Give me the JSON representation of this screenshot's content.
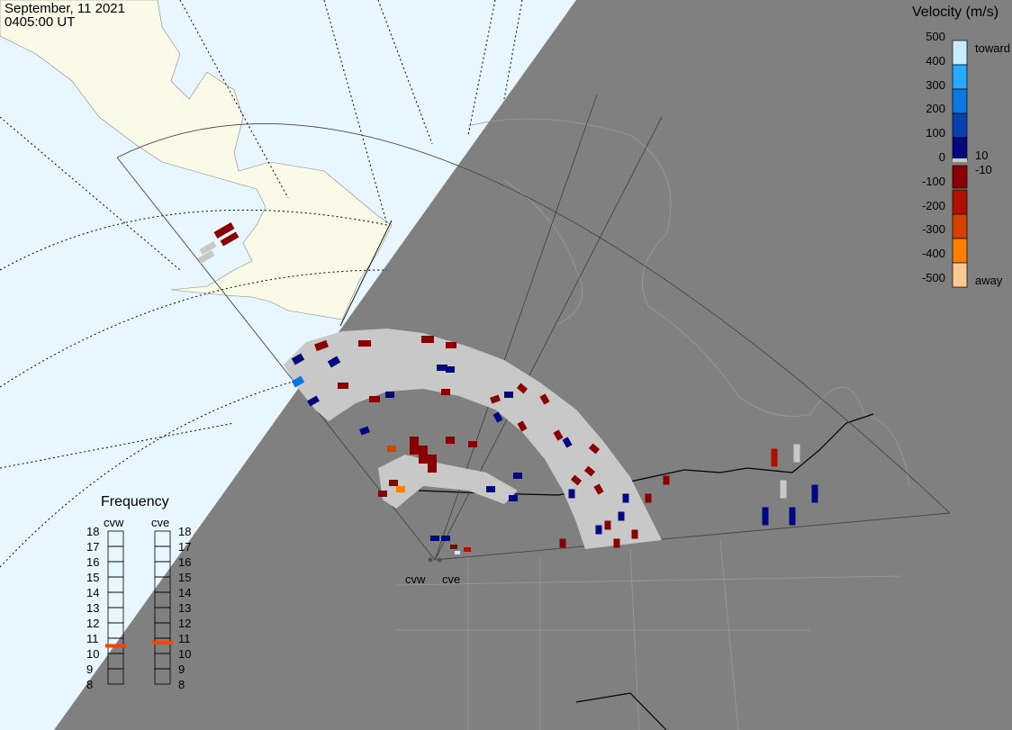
{
  "header": {
    "date": "September, 11 2021",
    "time": "0405:00 UT"
  },
  "radars": [
    {
      "name": "cvw",
      "frequency_mhz": 10.5
    },
    {
      "name": "cve",
      "frequency_mhz": 10.7
    }
  ],
  "velocity_scale": {
    "title": "Velocity (m/s)",
    "ticks": [
      "500",
      "400",
      "300",
      "200",
      "100",
      "0",
      "-100",
      "-200",
      "-300",
      "-400",
      "-500"
    ],
    "toward_label": "toward",
    "away_label": "away",
    "pos_threshold": "10",
    "neg_threshold": "-10",
    "colors": [
      "#c8ecff",
      "#28a8ff",
      "#0a78e0",
      "#0840b0",
      "#000880",
      "#8a0000",
      "#b01000",
      "#d84000",
      "#ff8000",
      "#ffc890"
    ]
  },
  "frequency_panel": {
    "title": "Frequency",
    "ticks": [
      "18",
      "17",
      "16",
      "15",
      "14",
      "13",
      "12",
      "11",
      "10",
      "9",
      "8"
    ],
    "marker_color": "#ff4000"
  },
  "colors": {
    "day": "#e8f6ff",
    "night": "#808080",
    "land_day": "#fafae8",
    "ground_scatter": "#c8c8c8"
  }
}
